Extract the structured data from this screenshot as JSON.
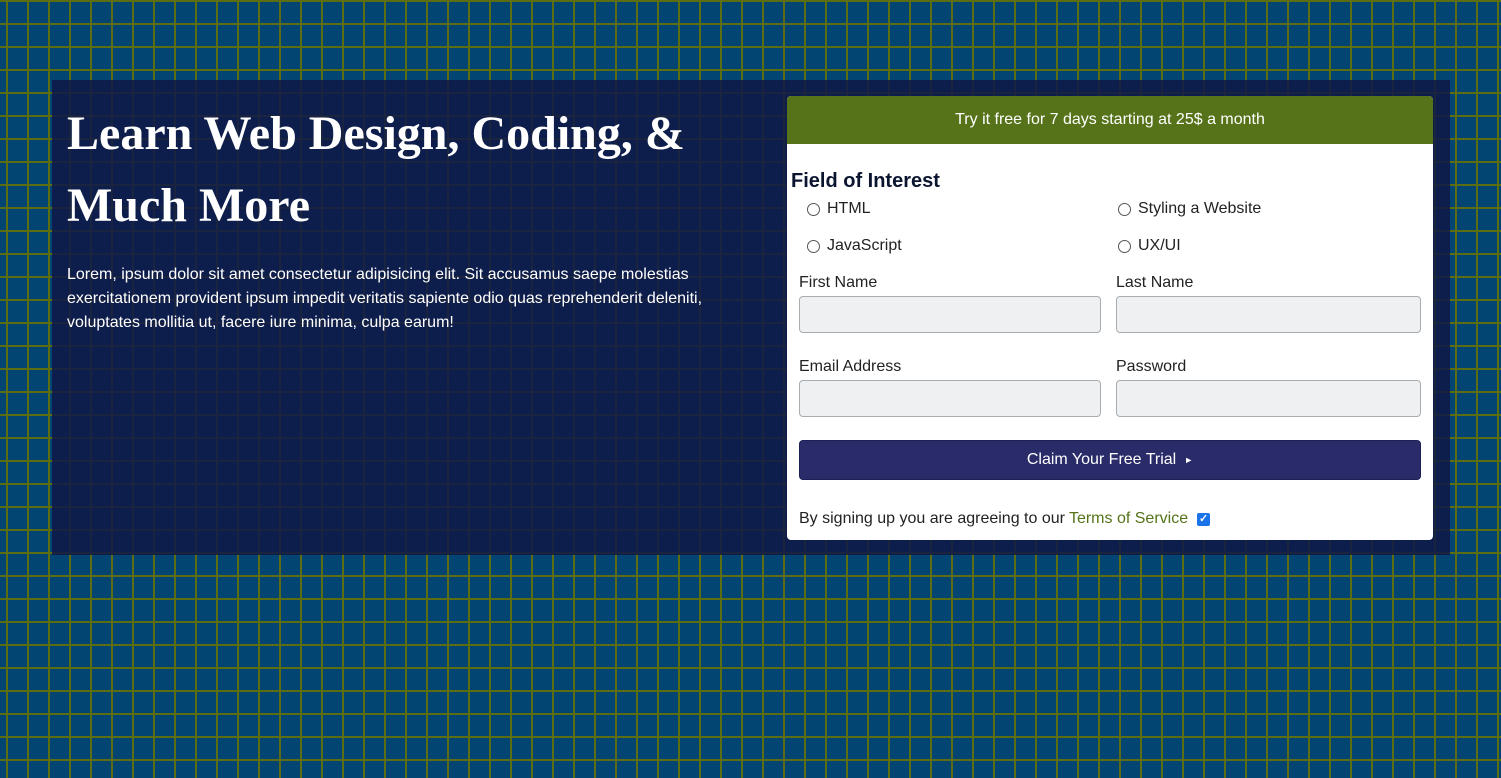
{
  "hero": {
    "title": "Learn Web Design, Coding, & Much More",
    "description": "Lorem, ipsum dolor sit amet consectetur adipisicing elit. Sit accusamus saepe molestias exercitationem provident ipsum impedit veritatis sapiente odio quas reprehenderit deleniti, voluptates mollitia ut, facere iure minima, culpa earum!"
  },
  "signup": {
    "banner": "Try it free for 7 days starting at 25$ a month",
    "field_of_interest_title": "Field of Interest",
    "interests": [
      {
        "label": "HTML",
        "selected": false
      },
      {
        "label": "Styling a Website",
        "selected": false
      },
      {
        "label": "JavaScript",
        "selected": false
      },
      {
        "label": "UX/UI",
        "selected": false
      }
    ],
    "first_name": {
      "label": "First Name",
      "value": ""
    },
    "last_name": {
      "label": "Last Name",
      "value": ""
    },
    "email": {
      "label": "Email Address",
      "value": ""
    },
    "password": {
      "label": "Password",
      "value": ""
    },
    "submit_label": "Claim Your Free Trial",
    "submit_icon": "triangle-right-icon",
    "terms_text": "By signing up you are agreeing to our",
    "terms_link": "Terms of Service",
    "terms_checked": true
  },
  "colors": {
    "background": "#024573",
    "brick_lines": "#5d6e12",
    "panel": "#101946",
    "banner": "#56731a",
    "button": "#2a2c6a",
    "link": "#56731a",
    "checkbox": "#1a73e8"
  }
}
